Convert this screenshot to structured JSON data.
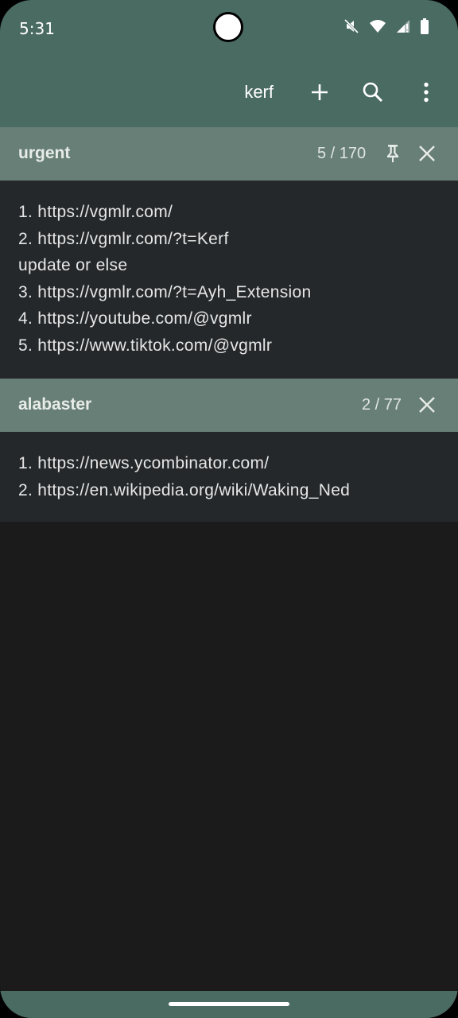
{
  "status_bar": {
    "time": "5:31",
    "icons": [
      "mute-icon",
      "wifi-icon",
      "signal-icon",
      "battery-icon"
    ]
  },
  "toolbar": {
    "title": "kerf",
    "actions": [
      "add-icon",
      "search-icon",
      "more-vert-icon"
    ]
  },
  "groups": [
    {
      "name": "urgent",
      "count": "5 / 170",
      "pinned": true,
      "lines": [
        "1. https://vgmlr.com/",
        "2. https://vgmlr.com/?t=Kerf",
        "update or else",
        "3. https://vgmlr.com/?t=Ayh_Extension",
        "4. https://youtube.com/@vgmlr",
        "5. https://www.tiktok.com/@vgmlr"
      ]
    },
    {
      "name": "alabaster",
      "count": "2 / 77",
      "pinned": false,
      "lines": [
        "1. https://news.ycombinator.com/",
        "2. https://en.wikipedia.org/wiki/Waking_Ned"
      ]
    }
  ],
  "colors": {
    "toolbar": "#4a6b62",
    "group_header": "#687f77",
    "group_body": "#25282b",
    "background": "#1b1b1b"
  }
}
